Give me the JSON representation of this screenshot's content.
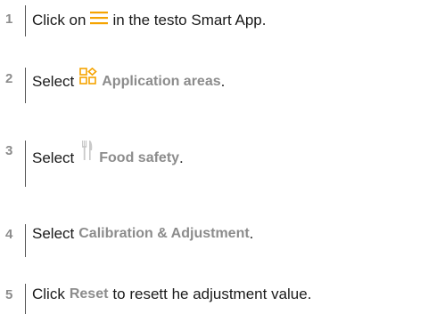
{
  "steps": [
    {
      "number": "1",
      "before": "Click on",
      "icon": "menu-icon",
      "after": "in the testo Smart App."
    },
    {
      "number": "2",
      "before": "Select",
      "icon": "application-areas-icon",
      "highlight": "Application areas",
      "after": "."
    },
    {
      "number": "3",
      "before": "Select",
      "icon": "food-safety-icon",
      "highlight": "Food safety",
      "after": "."
    },
    {
      "number": "4",
      "before": "Select",
      "highlight": "Calibration & Adjustment",
      "after": "."
    },
    {
      "number": "5",
      "before": "Click",
      "highlight": "Reset",
      "after": "to resett he adjustment value."
    }
  ],
  "colors": {
    "accent": "#f5a300",
    "highlight_text": "#8c8c8c",
    "body_text": "#1a1a1a",
    "step_number": "#8c8c8c"
  }
}
